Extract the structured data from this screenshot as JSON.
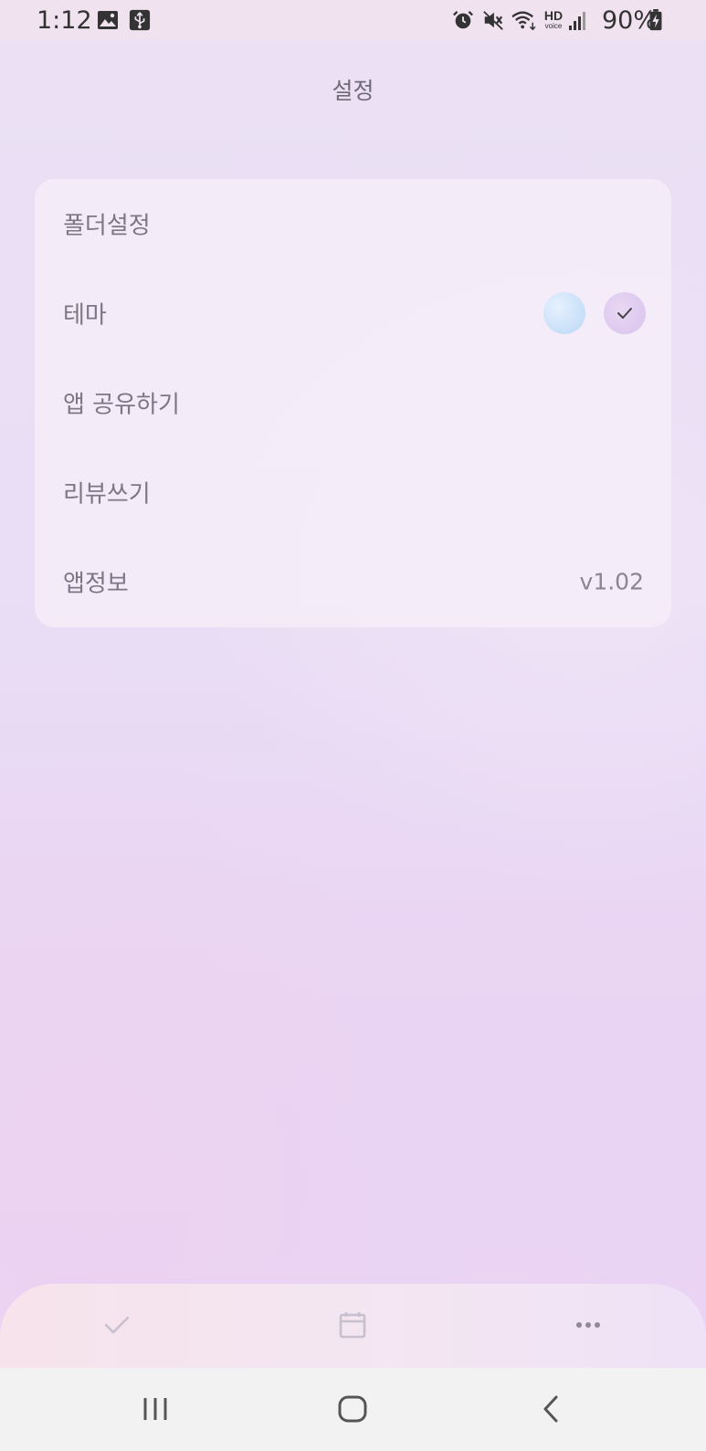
{
  "status_bar": {
    "time": "1:12",
    "battery": "90%",
    "icons": [
      "image-icon",
      "usb-icon",
      "alarm-icon",
      "vibrate-icon",
      "wifi-icon",
      "hd-voice-icon",
      "signal-icon",
      "battery-charging-icon"
    ],
    "hd_label": "HD",
    "voice_label": "voice"
  },
  "header": {
    "title": "설정"
  },
  "settings": {
    "items": [
      {
        "label": "폴더설정"
      },
      {
        "label": "테마"
      },
      {
        "label": "앱 공유하기"
      },
      {
        "label": "리뷰쓰기"
      },
      {
        "label": "앱정보",
        "value": "v1.02"
      }
    ],
    "theme_options": [
      {
        "name": "blue",
        "color": "#cfe4fb",
        "selected": false
      },
      {
        "name": "purple",
        "color": "#dfcaef",
        "selected": true
      }
    ]
  },
  "tab_bar": {
    "tabs": [
      {
        "icon": "check-icon"
      },
      {
        "icon": "calendar-icon"
      },
      {
        "icon": "more-icon"
      }
    ]
  },
  "system_nav": {
    "buttons": [
      {
        "icon": "recent-apps-icon"
      },
      {
        "icon": "home-icon"
      },
      {
        "icon": "back-icon"
      }
    ]
  },
  "colors": {
    "card_bg": "#f6f0fa",
    "text_primary": "#7b7787",
    "accent_purple": "#dfcaef",
    "accent_blue": "#cfe4fb"
  }
}
